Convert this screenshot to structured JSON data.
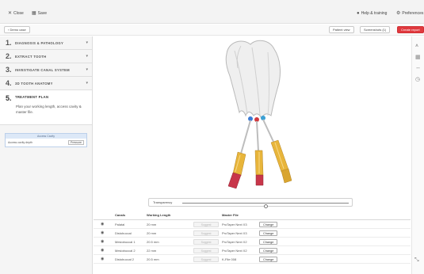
{
  "topbar": {
    "close_label": "Close",
    "save_label": "Save",
    "help_label": "Help & training",
    "preferences_label": "Preferences"
  },
  "subbar": {
    "demo_label": "Demo case",
    "patient_view_label": "Patient view",
    "screenshots_label": "Screenshots (1)",
    "create_report_label": "Create report"
  },
  "steps": [
    {
      "num": "1.",
      "label": "DIAGNOSIS & PATHOLOGY"
    },
    {
      "num": "2.",
      "label": "EXTRACT TOOTH"
    },
    {
      "num": "3.",
      "label": "INVESTIGATE CANAL SYSTEM"
    },
    {
      "num": "4.",
      "label": "3D TOOTH ANATOMY"
    },
    {
      "num": "5.",
      "label": "TREATMENT PLAN",
      "description": "Plan your working length, access cavity & master file."
    }
  ],
  "access_cavity": {
    "title": "Access Cavity",
    "row_label": "Access cavity depth",
    "value": "Pressure"
  },
  "transparency": {
    "label": "Transparency",
    "value": 0.5
  },
  "table": {
    "headers": {
      "canals": "Canals",
      "working_length": "Working Length",
      "master_file": "Master File"
    },
    "suggest_label": "Suggest",
    "change_label": "Change",
    "rows": [
      {
        "canal": "Palatal",
        "wl": "20 mm",
        "mf": "ProTaper Next X3"
      },
      {
        "canal": "Distobuccal",
        "wl": "20 mm",
        "mf": "ProTaper Next X3"
      },
      {
        "canal": "Mesiobuccal 1",
        "wl": "20.5 mm",
        "mf": "ProTaper Next X2"
      },
      {
        "canal": "Mesiobuccal 2",
        "wl": "22 mm",
        "mf": "ProTaper Next X2"
      },
      {
        "canal": "Distobuccal 2",
        "wl": "20.5 mm",
        "mf": "K-File 008"
      }
    ]
  },
  "colors": {
    "accent_red": "#e0393e",
    "file_yellow": "#e8b53a",
    "file_red": "#c8364a",
    "tooth_white": "#f2f2f2"
  }
}
